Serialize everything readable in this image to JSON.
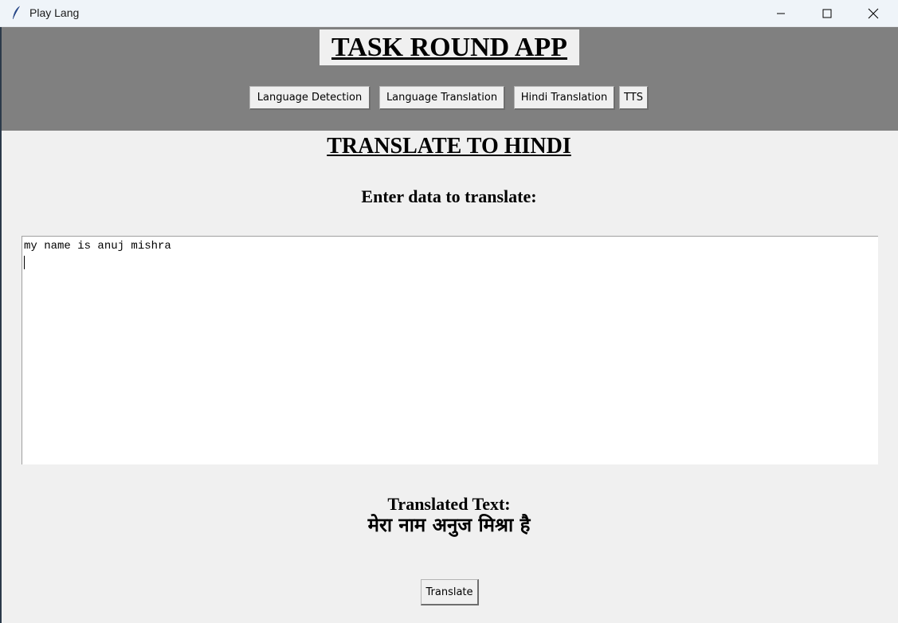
{
  "window": {
    "title": "Play Lang",
    "icons": [
      "feather-icon",
      "minimize-icon",
      "maximize-icon",
      "close-icon"
    ]
  },
  "header": {
    "app_title": "TASK ROUND APP",
    "nav": [
      {
        "label": "Language Detection"
      },
      {
        "label": "Language Translation"
      },
      {
        "label": "Hindi Translation"
      },
      {
        "label": "TTS"
      }
    ]
  },
  "main": {
    "heading": "TRANSLATE TO HINDI",
    "prompt": "Enter data to translate:",
    "input_value": "my name is anuj mishra",
    "output_label": "Translated Text:",
    "output_value": "मेरा नाम अनुज मिश्रा है",
    "translate_label": "Translate"
  },
  "colors": {
    "header_bg": "#808080",
    "window_bg": "#f0f0f0",
    "titlebar_bg": "#eff4f9"
  }
}
